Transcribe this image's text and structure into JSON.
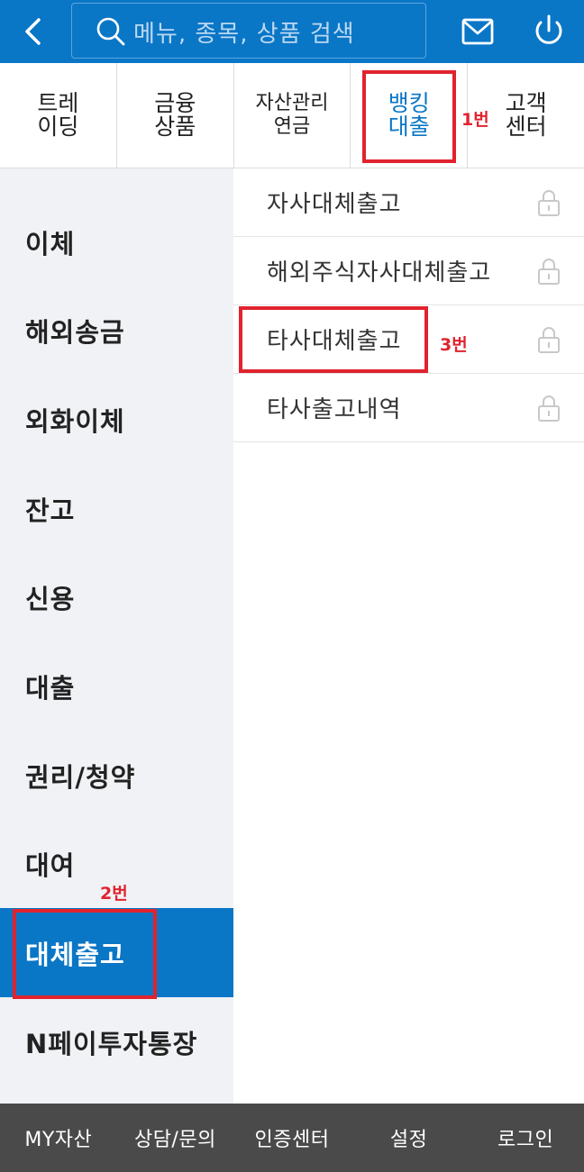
{
  "header": {
    "back_icon": "chevron-left-icon",
    "search_placeholder": "메뉴, 종목, 상품 검색",
    "mail_icon": "envelope-icon",
    "power_icon": "power-icon"
  },
  "colors": {
    "primary": "#0a76c6",
    "sidebar_bg": "#f0f2f5",
    "annotation_red": "#e0232e",
    "bottom_bar": "#4a4a4a"
  },
  "tabs": [
    {
      "line1": "트레",
      "line2": "이딩"
    },
    {
      "line1": "금융",
      "line2": "상품"
    },
    {
      "line1": "자산관리",
      "line2": "연금"
    },
    {
      "line1": "뱅킹",
      "line2": "대출",
      "active": true
    },
    {
      "line1": "고객",
      "line2": "센터"
    }
  ],
  "sidebar": {
    "items": [
      "이체",
      "해외송금",
      "외화이체",
      "잔고",
      "신용",
      "대출",
      "권리/청약",
      "대여",
      "대체출고",
      "N페이투자통장"
    ],
    "active_index": 8
  },
  "submenu": {
    "items": [
      "자사대체출고",
      "해외주식자사대체출고",
      "타사대체출고",
      "타사출고내역"
    ],
    "lock_icon": "lock-icon"
  },
  "annotations": {
    "a1": "1번",
    "a2": "2번",
    "a3": "3번"
  },
  "bottom_bar": [
    "MY자산",
    "상담/문의",
    "인증센터",
    "설정",
    "로그인"
  ]
}
